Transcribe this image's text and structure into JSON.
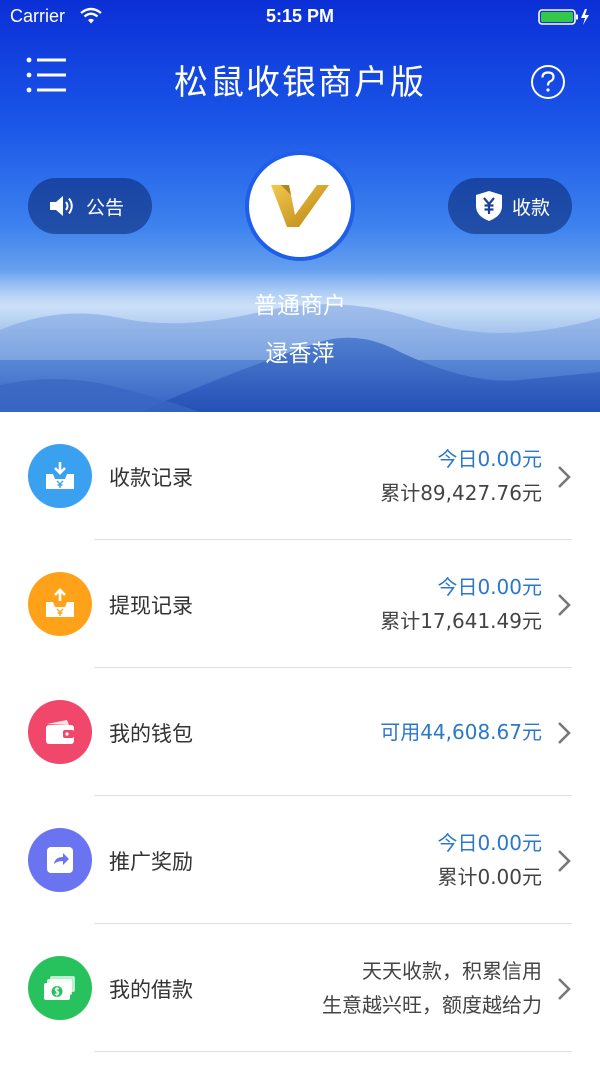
{
  "status_bar": {
    "carrier": "Carrier",
    "time": "5:15 PM"
  },
  "header": {
    "title": "松鼠收银商户版",
    "announcement_label": "公告",
    "collect_label": "收款",
    "merchant_type": "普通商户",
    "merchant_name": "逯香萍"
  },
  "rows": [
    {
      "label": "收款记录",
      "line1": "今日0.00元",
      "line2": "累计89,427.76元",
      "icon": "inbox-download-icon",
      "color": "#3aa0f0"
    },
    {
      "label": "提现记录",
      "line1": "今日0.00元",
      "line2": "累计17,641.49元",
      "icon": "inbox-upload-icon",
      "color": "#ffa21a"
    },
    {
      "label": "我的钱包",
      "line1": "可用44,608.67元",
      "icon": "wallet-icon",
      "color": "#f0476a"
    },
    {
      "label": "推广奖励",
      "line1": "今日0.00元",
      "line2": "累计0.00元",
      "icon": "share-icon",
      "color": "#6a74f0"
    },
    {
      "label": "我的借款",
      "line1": "天天收款，积累信用",
      "line2": "生意越兴旺，额度越给力",
      "icon": "cash-icon",
      "color": "#27c25e"
    }
  ],
  "colors": {
    "accent_blue": "#2b78c9",
    "header_blue": "#1a56e8"
  }
}
